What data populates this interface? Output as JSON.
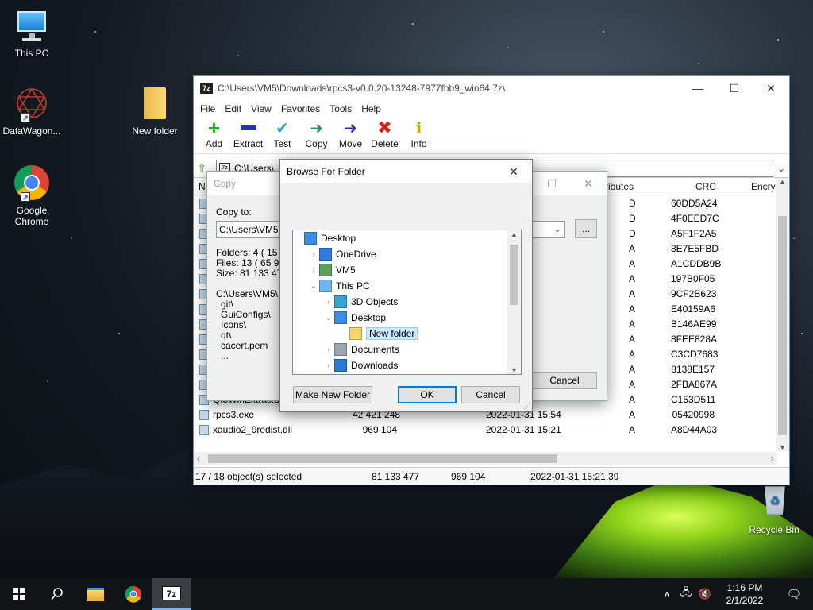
{
  "desktop": {
    "icons": [
      {
        "label": "This PC"
      },
      {
        "label": "DataWagon..."
      },
      {
        "label": "New folder"
      },
      {
        "label": "Google Chrome"
      },
      {
        "label": "Recycle Bin"
      }
    ]
  },
  "sevenzip": {
    "title": "C:\\Users\\VM5\\Downloads\\rpcs3-v0.0.20-13248-7977fbb9_win64.7z\\",
    "menu": [
      "File",
      "Edit",
      "View",
      "Favorites",
      "Tools",
      "Help"
    ],
    "toolbar": [
      "Add",
      "Extract",
      "Test",
      "Copy",
      "Move",
      "Delete",
      "Info"
    ],
    "address": "C:\\Users\\",
    "col_name": "N",
    "col_attributes": "ributes",
    "col_crc": "CRC",
    "col_encrypted": "Encry",
    "rows": [
      {
        "name": "",
        "size": "",
        "date": "",
        "attr": "D",
        "crc": "60DD5A24"
      },
      {
        "name": "",
        "size": "",
        "date": "",
        "attr": "D",
        "crc": "4F0EED7C"
      },
      {
        "name": "",
        "size": "",
        "date": "",
        "attr": "D",
        "crc": "A5F1F2A5"
      },
      {
        "name": "",
        "size": "",
        "date": "",
        "attr": "A",
        "crc": "8E7E5FBD"
      },
      {
        "name": "",
        "size": "",
        "date": "",
        "attr": "A",
        "crc": "A1CDDB9B"
      },
      {
        "name": "",
        "size": "",
        "date": "",
        "attr": "A",
        "crc": "197B0F05"
      },
      {
        "name": "",
        "size": "",
        "date": "",
        "attr": "A",
        "crc": "9CF2B623"
      },
      {
        "name": "",
        "size": "",
        "date": "",
        "attr": "A",
        "crc": "E40159A6"
      },
      {
        "name": "",
        "size": "",
        "date": "",
        "attr": "A",
        "crc": "B146AE99"
      },
      {
        "name": "",
        "size": "",
        "date": "",
        "attr": "A",
        "crc": "8FEE828A"
      },
      {
        "name": "",
        "size": "",
        "date": "",
        "attr": "A",
        "crc": "C3CD7683"
      },
      {
        "name": "",
        "size": "",
        "date": "",
        "attr": "A",
        "crc": "8138E157"
      },
      {
        "name": "",
        "size": "",
        "date": "",
        "attr": "A",
        "crc": "2FBA867A"
      },
      {
        "name": "Qt5WinExtras.dll",
        "size": "",
        "date": "",
        "attr": "A",
        "crc": "C153D511"
      },
      {
        "name": "rpcs3.exe",
        "size": "42 421 248",
        "date": "2022-01-31 15:54",
        "attr": "A",
        "crc": "05420998"
      },
      {
        "name": "xaudio2_9redist.dll",
        "size": "969 104",
        "date": "2022-01-31 15:21",
        "attr": "A",
        "crc": "A8D44A03"
      }
    ],
    "status": {
      "selected": "17 / 18 object(s) selected",
      "total_size": "81 133 477",
      "item_size": "969 104",
      "modified": "2022-01-31 15:21:39"
    }
  },
  "copy_dialog": {
    "title": "Copy",
    "copy_to_label": "Copy to:",
    "path": "C:\\Users\\VM5\\D",
    "browse": "...",
    "folders": "Folders: 4    ( 15 2",
    "files": "Files: 13    ( 65 9",
    "size": "Size: 81 133 477",
    "path_line": "C:\\Users\\VM5\\D",
    "items": [
      "git\\",
      "GuiConfigs\\",
      "Icons\\",
      "qt\\",
      "cacert.pem",
      "..."
    ],
    "cancel": "Cancel"
  },
  "browse_dialog": {
    "title": "Browse For Folder",
    "tree": [
      {
        "label": "Desktop",
        "level": 0,
        "exp": ""
      },
      {
        "label": "OneDrive",
        "level": 1,
        "exp": "›"
      },
      {
        "label": "VM5",
        "level": 1,
        "exp": "›"
      },
      {
        "label": "This PC",
        "level": 1,
        "exp": "⌄"
      },
      {
        "label": "3D Objects",
        "level": 2,
        "exp": "›"
      },
      {
        "label": "Desktop",
        "level": 2,
        "exp": "⌄"
      },
      {
        "label": "New folder",
        "level": 3,
        "exp": ""
      },
      {
        "label": "Documents",
        "level": 2,
        "exp": "›"
      },
      {
        "label": "Downloads",
        "level": 2,
        "exp": "›"
      }
    ],
    "make_new_folder": "Make New Folder",
    "ok": "OK",
    "cancel": "Cancel"
  },
  "taskbar": {
    "time": "1:16 PM",
    "date": "2/1/2022",
    "app_label": "7z"
  }
}
